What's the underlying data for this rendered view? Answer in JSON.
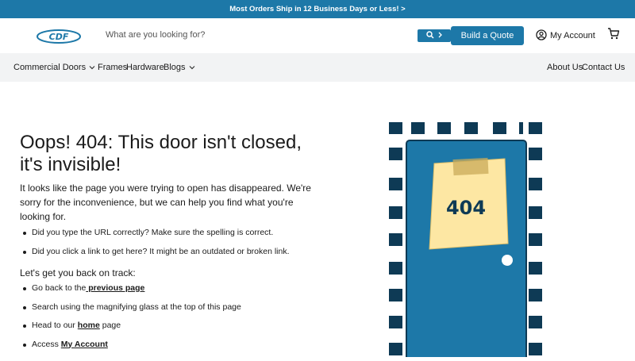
{
  "promo": {
    "text": "Most Orders Ship in 12 Business Days or Less! >"
  },
  "header": {
    "logo_text": "CDF",
    "search_placeholder": "What are you looking for?",
    "search_button_icon": "search-icon",
    "quote_label": "Build a Quote",
    "account_label": "My Account",
    "cart_icon": "cart-icon"
  },
  "nav": {
    "left": [
      {
        "label": "Commercial Doors",
        "has_dropdown": true
      },
      {
        "label": "Frames",
        "has_dropdown": false
      },
      {
        "label": "Hardware",
        "has_dropdown": false
      },
      {
        "label": "Blogs",
        "has_dropdown": true
      }
    ],
    "right": [
      {
        "label": "About Us"
      },
      {
        "label": "Contact Us"
      }
    ]
  },
  "error": {
    "title": "Oops! 404: This door isn't closed, it's invisible!",
    "intro": "It looks like the page you were trying to open has disappeared. We're sorry for the inconvenience, but we can help you find what you're looking for.",
    "checks": [
      "Did you type the URL correctly? Make sure the spelling is correct.",
      "Did you click a link to get here? It might be an outdated or broken link."
    ],
    "subhead": "Let's get you back on track:",
    "steps": {
      "back_prefix": "Go back to the",
      "back_link": " previous page",
      "search_text": "Search using the magnifying glass at the top of this page",
      "home_prefix": "Head to our ",
      "home_link": "home",
      "home_suffix": " page",
      "account_prefix": "Access ",
      "account_link": "My Account"
    }
  },
  "illustration": {
    "note_text": "404"
  },
  "colors": {
    "brand": "#1d78a8",
    "dark": "#0e3a55",
    "note": "#fde7a3"
  }
}
